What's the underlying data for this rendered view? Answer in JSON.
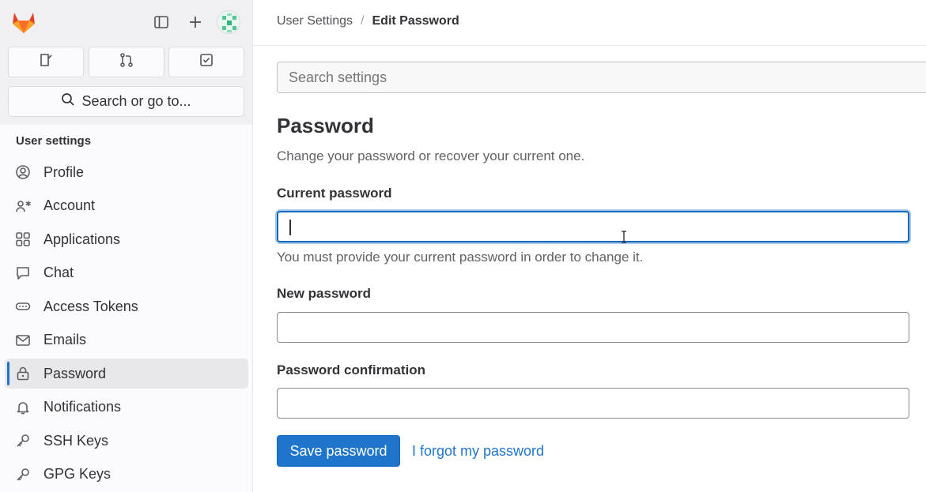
{
  "top": {
    "logo_icon": "tanuki-logo",
    "sidebar_toggle_icon": "sidebar-icon",
    "create_icon": "plus-icon",
    "avatar_icon": "user-avatar"
  },
  "quick_actions": [
    {
      "icon": "issues-icon"
    },
    {
      "icon": "merge-request-icon"
    },
    {
      "icon": "todo-icon"
    }
  ],
  "search": {
    "label": "Search or go to..."
  },
  "sidebar": {
    "section_title": "User settings",
    "items": [
      {
        "label": "Profile",
        "icon": "profile-icon"
      },
      {
        "label": "Account",
        "icon": "account-icon"
      },
      {
        "label": "Applications",
        "icon": "applications-icon"
      },
      {
        "label": "Chat",
        "icon": "chat-icon"
      },
      {
        "label": "Access Tokens",
        "icon": "token-icon"
      },
      {
        "label": "Emails",
        "icon": "mail-icon"
      },
      {
        "label": "Password",
        "icon": "lock-icon",
        "active": true
      },
      {
        "label": "Notifications",
        "icon": "bell-icon"
      },
      {
        "label": "SSH Keys",
        "icon": "key-icon"
      },
      {
        "label": "GPG Keys",
        "icon": "key-icon"
      }
    ]
  },
  "breadcrumb": {
    "parent": "User Settings",
    "separator": "/",
    "current": "Edit Password"
  },
  "settings_search": {
    "placeholder": "Search settings"
  },
  "main": {
    "title": "Password",
    "description": "Change your password or recover your current one.",
    "current_password": {
      "label": "Current password",
      "value": "",
      "help": "You must provide your current password in order to change it."
    },
    "new_password": {
      "label": "New password",
      "value": ""
    },
    "confirm_password": {
      "label": "Password confirmation",
      "value": ""
    },
    "save_label": "Save password",
    "forgot_label": "I forgot my password"
  },
  "colors": {
    "accent": "#1f75cb",
    "focus_ring": "#1068bf",
    "logo_orange": "#e24329"
  }
}
